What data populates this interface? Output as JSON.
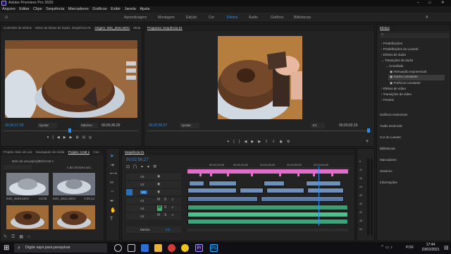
{
  "app": {
    "title": "Adobe Premiere Pro 2020"
  },
  "menu": [
    "Arquivo",
    "Editar",
    "Clipe",
    "Sequência",
    "Marcadores",
    "Gráficos",
    "Exibir",
    "Janela",
    "Ajuda"
  ],
  "workspaces": [
    "Aprendizagem",
    "Montagem",
    "Edição",
    "Cor",
    "Efeitos",
    "Áudio",
    "Gráficos",
    "Bibliotecas"
  ],
  "workspace_active": "Efeitos",
  "source": {
    "tabs": [
      "Controles de efeitos",
      "Mixer de faixas de áudio: Sequência 01",
      "Origem: IMG_3041.MOV",
      "Meta"
    ],
    "timecode_left": "00;00;17;29",
    "fit": "Ajustar",
    "quality": "Máximo",
    "timecode_right": "00;00;36;29"
  },
  "program": {
    "tab": "Programa: Sequência 01",
    "timecode_left": "00;02;56;27",
    "fit": "Ajustar",
    "quality": "1/4",
    "timecode_right": "00;03;03;19"
  },
  "project": {
    "tabs": [
      "Projeto: Bolo de uva",
      "Navegador de mídia",
      "Projeto: CAM 1",
      "Con"
    ],
    "path": "Bolo de uva.prproj\\Bin\\CAM 1",
    "count": "1 de 20 itens sel...",
    "thumbs": [
      {
        "name": "IMG_3040.MOV",
        "dur": "13;28"
      },
      {
        "name": "IMG_3041.MOV",
        "dur": "1;09;14"
      },
      {
        "name": "",
        "dur": ""
      },
      {
        "name": "",
        "dur": ""
      }
    ]
  },
  "timeline": {
    "tab": "Sequência 01",
    "timecode": "00;02;56;27",
    "ruler": [
      "00;02;32;00",
      "00;02;40;00",
      "00;02;48;00",
      "00;02;56;00",
      "00;03;04;00"
    ],
    "tracks": [
      "V3",
      "V2",
      "V1",
      "A1",
      "A2",
      "A3",
      "Mestre"
    ],
    "master_value": "0,0"
  },
  "effects": {
    "title": "Efeitos",
    "tree": [
      "Predefinições",
      "Predefinições do Lumetri",
      "Efeitos de áudio",
      "Transições de áudio",
      "Crossfade",
      "Atenuação exponencial",
      "Ganho constante",
      "Potência constante",
      "Efeitos de vídeo",
      "Transições de vídeo",
      "Presets"
    ],
    "selected_index": 6,
    "panels": [
      "Gráficos essenciais",
      "Áudio essencial",
      "Cor do Lumetri",
      "Bibliotecas",
      "Marcadores",
      "Histórico",
      "Informações"
    ]
  },
  "meter": {
    "labels": [
      "-6",
      "-12",
      "-18",
      "-24",
      "-30",
      "-36",
      "-42",
      "-48",
      "-54"
    ]
  },
  "taskbar": {
    "search": "Digite aqui para pesquisar",
    "time": "17:44",
    "date": "23/02/2021",
    "lang": "POR"
  },
  "colors": {
    "accent": "#2d8ceb",
    "video_clip": "#6f8fb8",
    "audio_clip": "#46b58b",
    "marker": "#e06ec8"
  }
}
